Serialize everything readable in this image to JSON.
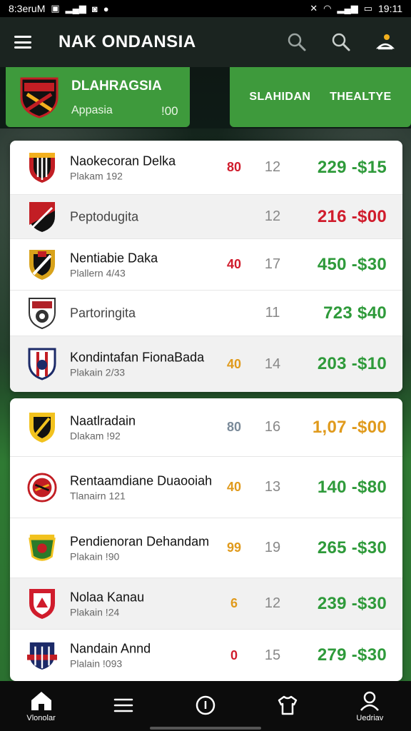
{
  "status_bar": {
    "left_text": "8:3eruM",
    "time": "19:11"
  },
  "app_bar": {
    "title": "NAK ONDANSIA",
    "actions": [
      "search-icon",
      "search-icon",
      "profile-icon"
    ]
  },
  "header": {
    "team_name": "DLAHRAGSIA",
    "team_sub": "Appasia",
    "team_num": "!00",
    "tabs": [
      "SLAHIDAN",
      "THEALTYE"
    ]
  },
  "colors": {
    "green": "#2e9a3a",
    "red": "#d01c2c",
    "orange": "#e09a1c",
    "header_green": "#3e9a3c"
  },
  "card1_rows": [
    {
      "name": "Naokecoran Delka",
      "sub": "Plakam 192",
      "score": "80",
      "score_color": "#d01c2c",
      "games": "12",
      "price": "229 -$15",
      "price_color": "#2e9a3a",
      "alt": false,
      "crest": [
        "#c21e24",
        "#f2b01e"
      ]
    },
    {
      "name": "Peptodugita",
      "sub": "",
      "score": "",
      "score_color": "#d01c2c",
      "games": "12",
      "price": "216 -$00",
      "price_color": "#d01c2c",
      "alt": true,
      "crest": [
        "#c21e24",
        "#111111"
      ]
    },
    {
      "name": "Nentiabie Daka",
      "sub": "Plallern 4/43",
      "score": "40",
      "score_color": "#d01c2c",
      "games": "17",
      "price": "450 -$30",
      "price_color": "#2e9a3a",
      "alt": false,
      "crest": [
        "#d8a21a",
        "#111111"
      ]
    },
    {
      "name": "Partoringita",
      "sub": "",
      "score": "",
      "score_color": "#d01c2c",
      "games": "11",
      "price": "723 $40",
      "price_color": "#2e9a3a",
      "alt": false,
      "crest": [
        "#b02128",
        "#333333"
      ]
    },
    {
      "name": "Kondintafan FionaBada",
      "sub": "Plakain 2/33",
      "score": "40",
      "score_color": "#e09a1c",
      "games": "14",
      "price": "203 -$10",
      "price_color": "#2e9a3a",
      "alt": true,
      "crest": [
        "#1c2a68",
        "#c21e24"
      ]
    }
  ],
  "card2_rows": [
    {
      "name": "Naatlradain",
      "sub": "Dlakam !92",
      "score": "80",
      "score_color": "#7a8a99",
      "games": "16",
      "price": "1,07 -$00",
      "price_color": "#e09a1c",
      "alt": false,
      "crest": [
        "#f2c21e",
        "#111111"
      ]
    },
    {
      "name": "Rentaamdiane Duaooiah",
      "sub": "Tlanairn 121",
      "score": "40",
      "score_color": "#e09a1c",
      "games": "13",
      "price": "140 -$80",
      "price_color": "#2e9a3a",
      "alt": false,
      "crest": [
        "#c21e24",
        "#f2b01e"
      ]
    },
    {
      "name": "Pendienoran Dehandam",
      "sub": "Plakain !90",
      "score": "99",
      "score_color": "#e09a1c",
      "games": "19",
      "price": "265 -$30",
      "price_color": "#2e9a3a",
      "alt": false,
      "crest": [
        "#2a7a2a",
        "#f2c21e"
      ]
    },
    {
      "name": "Nolaa Kanau",
      "sub": "Plakain !24",
      "score": "6",
      "score_color": "#e09a1c",
      "games": "12",
      "price": "239 -$30",
      "price_color": "#2e9a3a",
      "alt": true,
      "crest": [
        "#d01c2c",
        "#ffffff"
      ]
    },
    {
      "name": "Nandain Annd",
      "sub": "Plalain !093",
      "score": "0",
      "score_color": "#d01c2c",
      "games": "15",
      "price": "279 -$30",
      "price_color": "#2e9a3a",
      "alt": false,
      "crest": [
        "#1c2a68",
        "#c21e24"
      ]
    }
  ],
  "bottom_nav": [
    {
      "label": "Vlonolar",
      "icon": "home-icon"
    },
    {
      "label": "",
      "icon": "list-icon"
    },
    {
      "label": "",
      "icon": "info-icon"
    },
    {
      "label": "",
      "icon": "jersey-icon"
    },
    {
      "label": "Uedriav",
      "icon": "profile-icon"
    }
  ]
}
